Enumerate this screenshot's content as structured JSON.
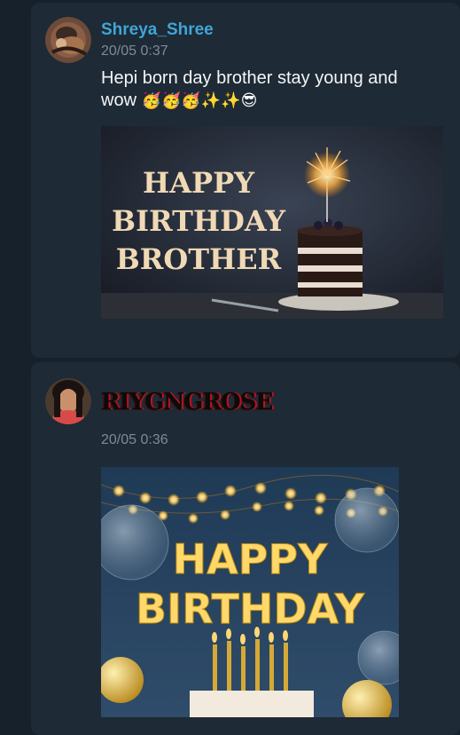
{
  "messages": [
    {
      "author": "Shreya_Shree",
      "timestamp": "20/05 0:37",
      "text": "Hepi born day brother stay young and wow",
      "emojis": "🥳🥳🥳✨✨😎",
      "image": {
        "lines": [
          "HAPPY",
          "BIRTHDAY",
          "BROTHER"
        ]
      }
    },
    {
      "author": "RIYGNGROSE",
      "timestamp": "20/05 0:36",
      "image": {
        "lines": [
          "HAPPY",
          "BIRTHDAY"
        ]
      }
    }
  ],
  "colors": {
    "background": "#17212b",
    "card": "#1e2a35",
    "author_name": "#3fa6d8",
    "timestamp": "#7d8b98",
    "message_text": "#f4f6f8"
  }
}
